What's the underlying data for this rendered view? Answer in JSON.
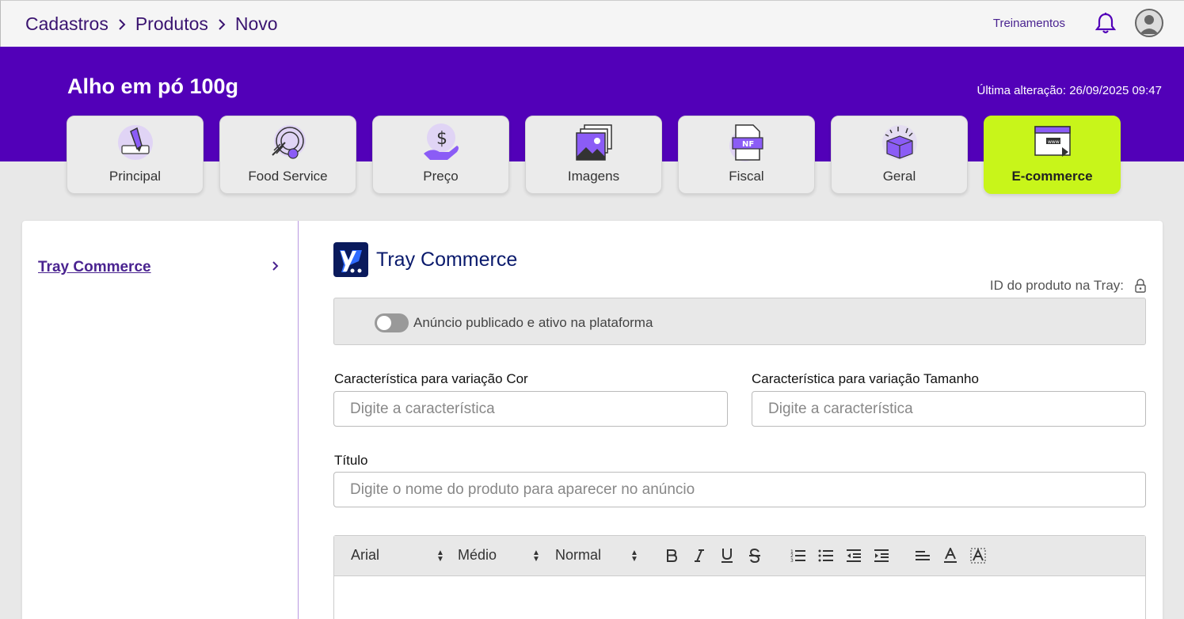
{
  "breadcrumb": {
    "items": [
      "Cadastros",
      "Produtos",
      "Novo"
    ]
  },
  "topbar": {
    "training_label": "Treinamentos"
  },
  "header": {
    "product_title": "Alho em pó 100g",
    "last_change": "Última alteração: 26/09/2025 09:47"
  },
  "tabs": [
    {
      "label": "Principal",
      "icon": "pencil-icon",
      "active": false
    },
    {
      "label": "Food Service",
      "icon": "plate-icon",
      "active": false
    },
    {
      "label": "Preço",
      "icon": "price-hand-icon",
      "active": false
    },
    {
      "label": "Imagens",
      "icon": "images-icon",
      "active": false
    },
    {
      "label": "Fiscal",
      "icon": "nf-document-icon",
      "active": false
    },
    {
      "label": "Geral",
      "icon": "box-icon",
      "active": false
    },
    {
      "label": "E-commerce",
      "icon": "browser-icon",
      "active": true
    }
  ],
  "sidenav": {
    "items": [
      {
        "label": "Tray Commerce"
      }
    ]
  },
  "tray": {
    "title": "Tray Commerce",
    "id_label": "ID do produto na Tray:",
    "toggle_label": "Anúncio publicado e ativo na plataforma",
    "toggle_on": false
  },
  "form": {
    "color_label": "Característica para variação Cor",
    "color_placeholder": "Digite a característica",
    "size_label": "Característica para variação Tamanho",
    "size_placeholder": "Digite a característica",
    "title_label": "Título",
    "title_placeholder": "Digite o nome do produto para aparecer no anúncio"
  },
  "editor": {
    "font_family": "Arial",
    "font_size": "Médio",
    "paragraph": "Normal"
  },
  "colors": {
    "primary": "#5200b8",
    "accent": "#c8f51a",
    "link": "#4a2390"
  }
}
